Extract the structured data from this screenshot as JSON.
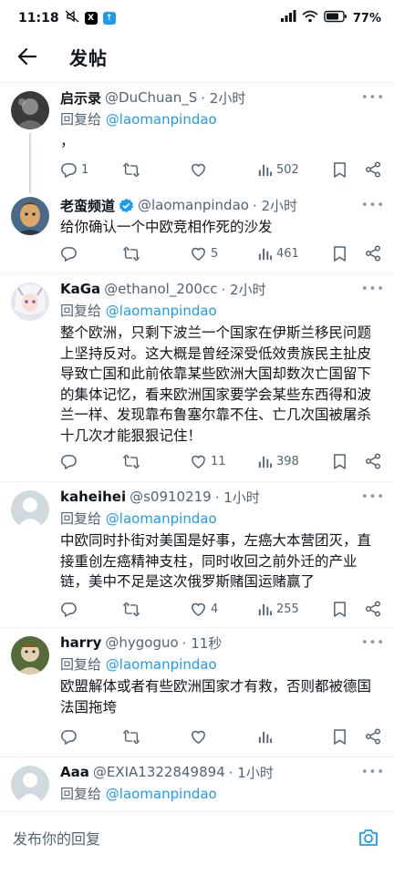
{
  "status_bar": {
    "time": "11:18",
    "battery": "77"
  },
  "header": {
    "title": "发帖"
  },
  "posts": [
    {
      "name": "启示录",
      "handle": "@DuChuan_S",
      "time": "· 2小时",
      "reply_to_prefix": "回复给 ",
      "reply_to": "@laomanpindao",
      "text": "，",
      "replies": "1",
      "retweets": "",
      "likes": "",
      "views": "502"
    },
    {
      "name": "老蛮频道",
      "verified": true,
      "handle": "@laomanpindao",
      "time": "· 2小时",
      "text": "给你确认一个中欧竞相作死的沙发",
      "replies": "",
      "retweets": "",
      "likes": "5",
      "views": "461"
    },
    {
      "name": "KaGa",
      "handle": "@ethanol_200cc",
      "time": "· 2小时",
      "reply_to_prefix": "回复给 ",
      "reply_to": "@laomanpindao",
      "text": "整个欧洲，只剩下波兰一个国家在伊斯兰移民问题上坚持反对。这大概是曾经深受低效贵族民主扯皮导致亡国和此前依靠某些欧洲大国却数次亡国留下的集体记忆，看来欧洲国家要学会某些东西得和波兰一样、发现靠布鲁塞尔靠不住、亡几次国被屠杀十几次才能狠狠记住！",
      "replies": "",
      "retweets": "",
      "likes": "11",
      "views": "398"
    },
    {
      "name": "kaheihei",
      "handle": "@s0910219",
      "time": "· 1小时",
      "reply_to_prefix": "回复给 ",
      "reply_to": "@laomanpindao",
      "text": "中欧同时扑街对美国是好事，左癌大本营团灭，直接重创左癌精神支柱，同时收回之前外迁的产业链，美中不足是这次俄罗斯赌国运赌赢了",
      "replies": "",
      "retweets": "",
      "likes": "4",
      "views": "255"
    },
    {
      "name": "harry",
      "handle": "@hygoguo",
      "time": "· 11秒",
      "reply_to_prefix": "回复给 ",
      "reply_to": "@laomanpindao",
      "text": "欧盟解体或者有些欧洲国家才有救，否则都被德国法国拖垮",
      "replies": "",
      "retweets": "",
      "likes": "",
      "views": ""
    },
    {
      "name": "Aaa",
      "handle": "@EXIA1322849894",
      "time": "· 1小时",
      "reply_to_prefix": "回复给 ",
      "reply_to": "@laomanpindao",
      "text": "",
      "replies": "",
      "retweets": "",
      "likes": "",
      "views": ""
    }
  ],
  "reply_bar": {
    "placeholder": "发布你的回复"
  },
  "colors": {
    "accent": "#1d9bf0",
    "muted": "#536471",
    "text": "#0f1419",
    "verified": "#1d9bf0"
  },
  "icons": [
    "back-arrow-icon",
    "reply-icon",
    "retweet-icon",
    "like-icon",
    "views-icon",
    "bookmark-icon",
    "share-icon",
    "more-icon",
    "verified-icon",
    "camera-icon"
  ]
}
